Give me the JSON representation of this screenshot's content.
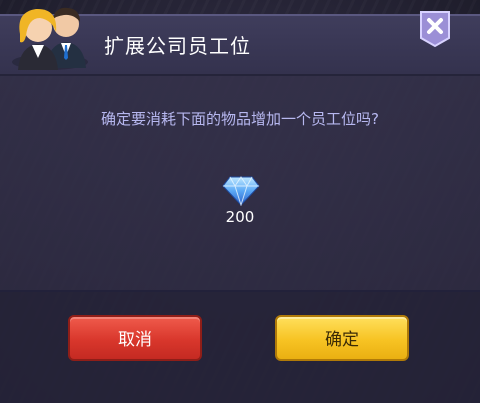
{
  "dialog": {
    "title": "扩展公司员工位",
    "close_icon": "close-icon",
    "avatar_icon": "staff-avatar-icon"
  },
  "message": "确定要消耗下面的物品增加一个员工位吗?",
  "cost": {
    "item_icon": "diamond-gem-icon",
    "amount": "200"
  },
  "buttons": {
    "cancel_label": "取消",
    "confirm_label": "确定"
  },
  "colors": {
    "cancel": "#d9372c",
    "confirm": "#f7c323",
    "close": "#9b8fd6",
    "message": "#b7b8f0"
  }
}
